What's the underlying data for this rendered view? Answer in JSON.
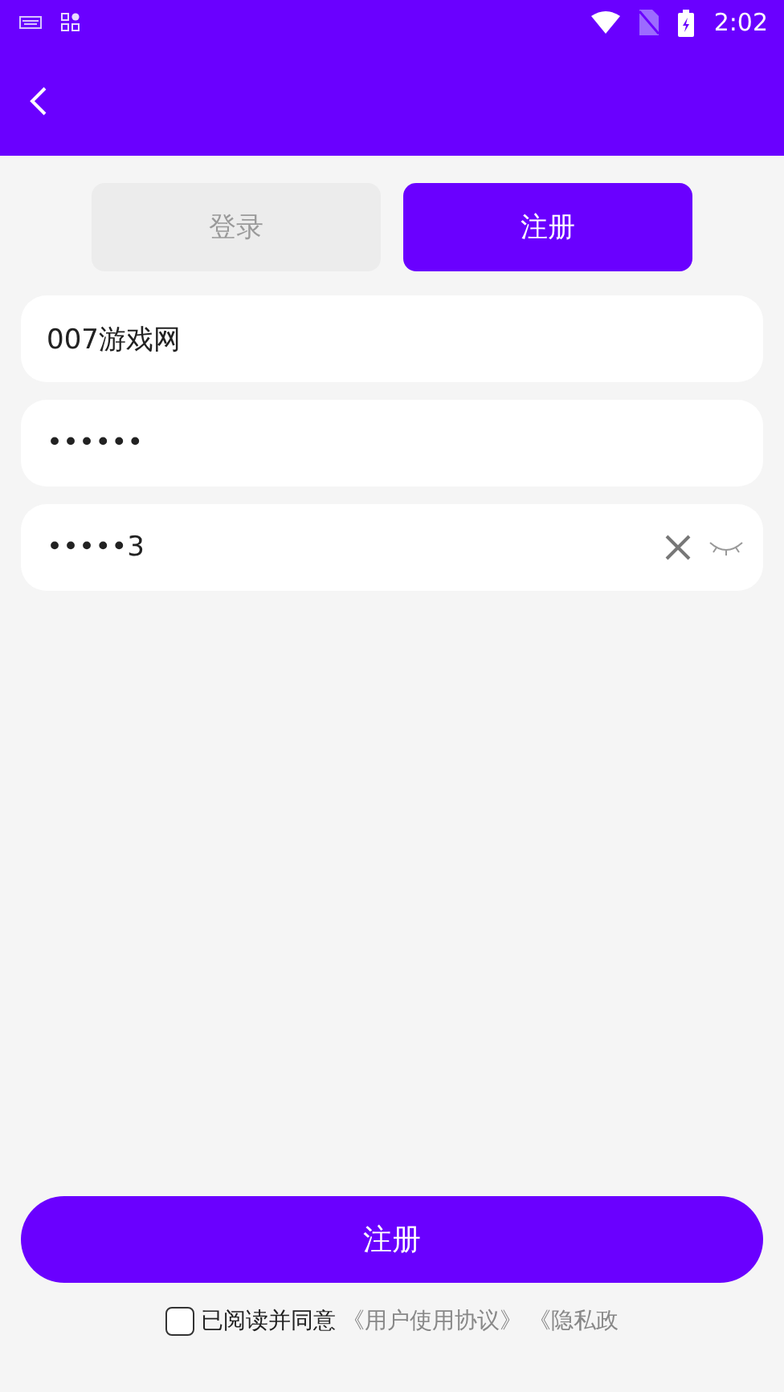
{
  "status_bar": {
    "time": "2:02"
  },
  "tabs": [
    {
      "label": "登录",
      "selected": false
    },
    {
      "label": "注册",
      "selected": true
    }
  ],
  "fields": [
    {
      "value": "007游戏网",
      "kind": "plain"
    },
    {
      "value": "••••••",
      "kind": "plain"
    },
    {
      "value": "•••••3",
      "kind": "password"
    }
  ],
  "submit": "注册",
  "agreement": {
    "checked": false,
    "text": "已阅读并同意",
    "links": [
      "《用户使用协议》",
      "《隐私政"
    ]
  }
}
